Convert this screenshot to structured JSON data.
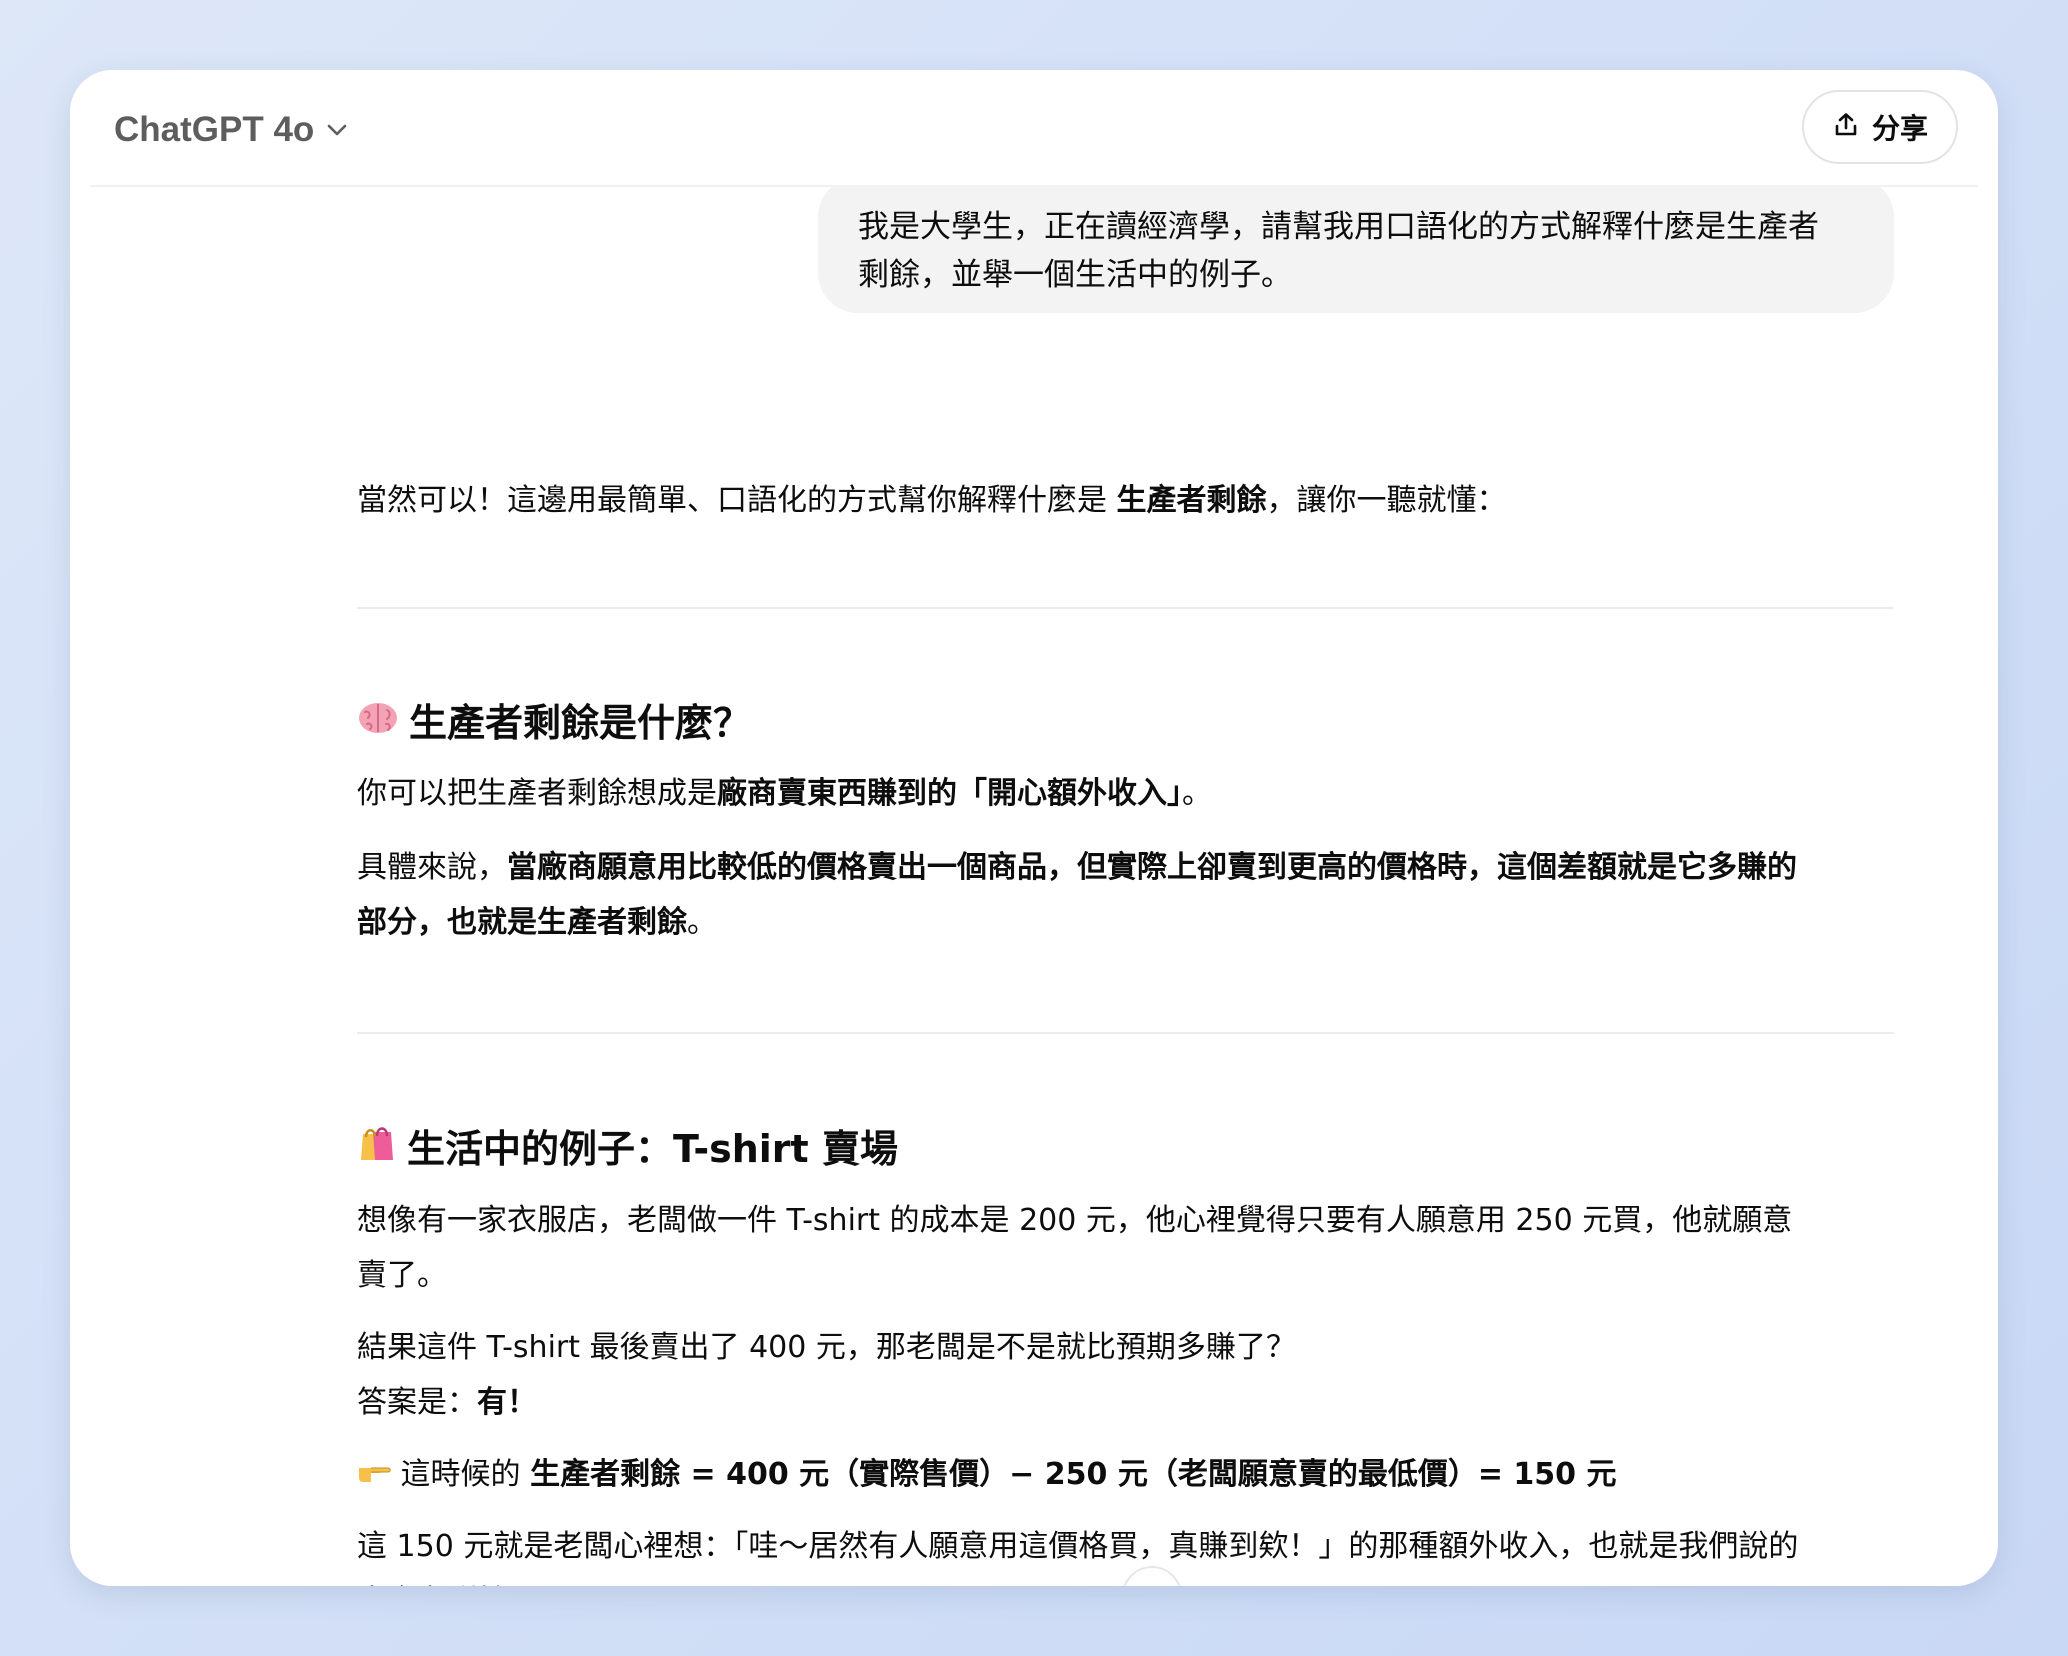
{
  "header": {
    "model_name": "ChatGPT 4o",
    "share_label": "分享"
  },
  "user_message": {
    "line1": "我是大學生，正在讀經濟學，請幫我用口語化的方式解釋什麼是生產者",
    "line2": "剩餘，並舉一個生活中的例子。"
  },
  "assistant": {
    "intro_a": "當然可以！這邊用最簡單、口語化的方式幫你解釋什麼是 ",
    "intro_b": "生產者剩餘",
    "intro_c": "，讓你一聽就懂：",
    "section1": {
      "heading": "生產者剩餘是什麼？",
      "p1_a": "你可以把生產者剩餘想成是",
      "p1_b": "廠商賣東西賺到的「開心額外收入」",
      "p1_c": "。",
      "p2_a": "具體來說，",
      "p2_b1": "當廠商願意用比較低的價格賣出一個商品，但實際上卻賣到更高的價格時，這個差額就是它多賺的",
      "p2_b2": "部分，也就是生產者剩餘",
      "p2_c": "。"
    },
    "section2": {
      "heading": "生活中的例子：T-shirt 賣場",
      "p1_l1": "想像有一家衣服店，老闆做一件 T-shirt 的成本是 200 元，他心裡覺得只要有人願意用 250 元買，他就願意",
      "p1_l2": "賣了。",
      "p2_l1": "結果這件 T-shirt 最後賣出了 400 元，那老闆是不是就比預期多賺了？",
      "p2_l2a": "答案是：",
      "p2_l2b": "有！",
      "p3_a": " 這時候的 ",
      "p3_b": "生產者剩餘 = 400 元（實際售價）− 250 元（老闆願意賣的最低價）= 150 元",
      "p4_l1": "這 150 元就是老闆心裡想：「哇～居然有人願意用這價格買，真賺到欸！」的那種額外收入，也就是我們說的",
      "p4_l2": "生產者剩餘。"
    }
  },
  "icons": {
    "chevron": "chevron-down-icon",
    "share": "share-icon",
    "brain": "brain-emoji-icon",
    "bag": "shopping-bag-emoji-icon",
    "point": "pointing-hand-emoji-icon"
  }
}
